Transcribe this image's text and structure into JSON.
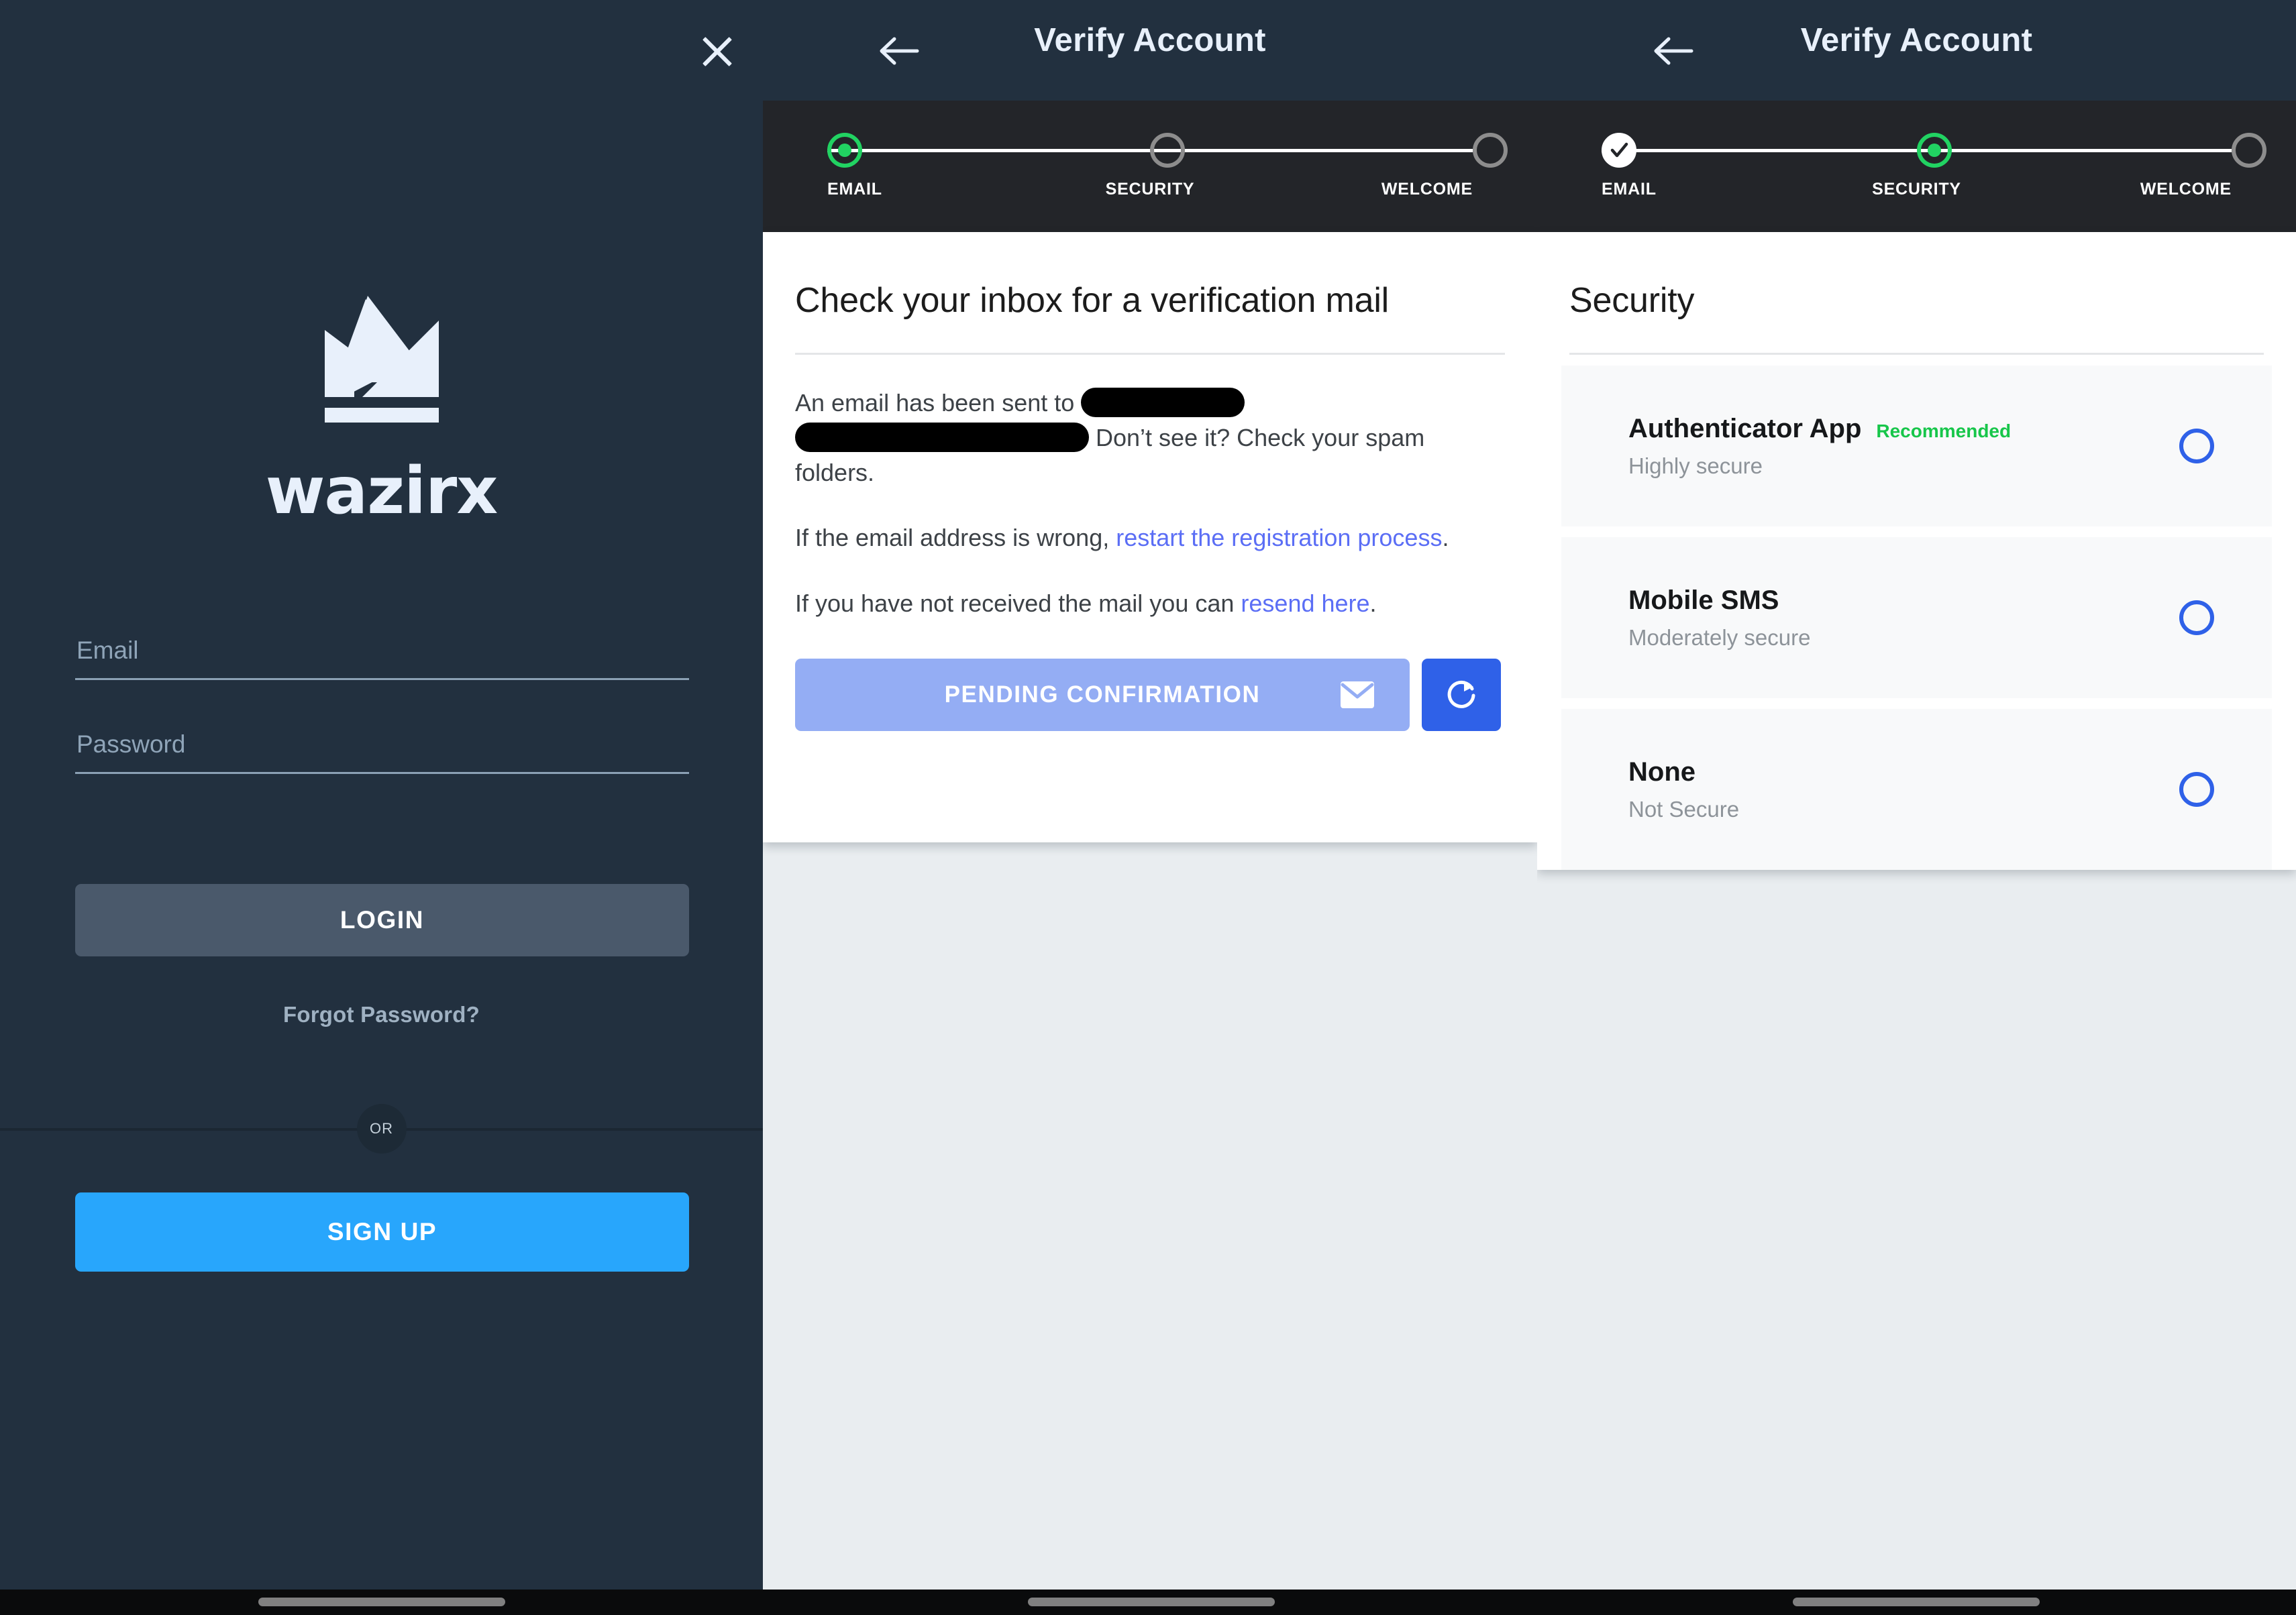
{
  "colors": {
    "brand_dark": "#22303f",
    "stepper_bg": "#232529",
    "accent_blue": "#28a6fc",
    "link_blue": "#5b6ef5",
    "primary_blue": "#2f61e8",
    "pending_blue": "#94adf4",
    "success_green": "#21d362",
    "badge_green": "#17c64a",
    "page_bg": "#e9edf0"
  },
  "panel_login": {
    "close_icon": "close-icon",
    "brand_name": "wazirx",
    "logo_icon": "wazirx-crown-logo",
    "email": {
      "placeholder": "Email",
      "value": ""
    },
    "password": {
      "placeholder": "Password",
      "value": ""
    },
    "login_label": "LOGIN",
    "forgot_label": "Forgot Password?",
    "or_label": "OR",
    "signup_label": "SIGN UP"
  },
  "panel_email": {
    "appbar": {
      "back_icon": "back-arrow-icon",
      "title": "Verify Account"
    },
    "stepper": {
      "steps": [
        {
          "label": "EMAIL",
          "state": "active"
        },
        {
          "label": "SECURITY",
          "state": "pending"
        },
        {
          "label": "WELCOME",
          "state": "pending"
        }
      ]
    },
    "card_title": "Check your inbox for a verification mail",
    "sent_prefix": "An email has been sent to",
    "sent_email_redacted": "██████████████████████",
    "spam_text": "Don’t see it? Check your spam folders.",
    "wrong_prefix": "If the email address is wrong,",
    "wrong_link": "restart the registration process",
    "wrong_suffix": ".",
    "resend_prefix": "If you have not received the mail you can",
    "resend_link": "resend here",
    "resend_suffix": ".",
    "pending_label": "PENDING CONFIRMATION",
    "pending_icon": "envelope-icon",
    "refresh_icon": "refresh-icon"
  },
  "panel_security": {
    "appbar": {
      "back_icon": "back-arrow-icon",
      "title": "Verify Account"
    },
    "stepper": {
      "steps": [
        {
          "label": "EMAIL",
          "state": "done"
        },
        {
          "label": "SECURITY",
          "state": "active"
        },
        {
          "label": "WELCOME",
          "state": "pending"
        }
      ]
    },
    "card_title": "Security",
    "options": [
      {
        "name": "Authenticator App",
        "badge": "Recommended",
        "sub": "Highly secure",
        "selected": false
      },
      {
        "name": "Mobile SMS",
        "badge": "",
        "sub": "Moderately secure",
        "selected": false
      },
      {
        "name": "None",
        "badge": "",
        "sub": "Not Secure",
        "selected": false
      }
    ]
  },
  "system_nav": {
    "handle_icon": "home-gesture-handle"
  }
}
